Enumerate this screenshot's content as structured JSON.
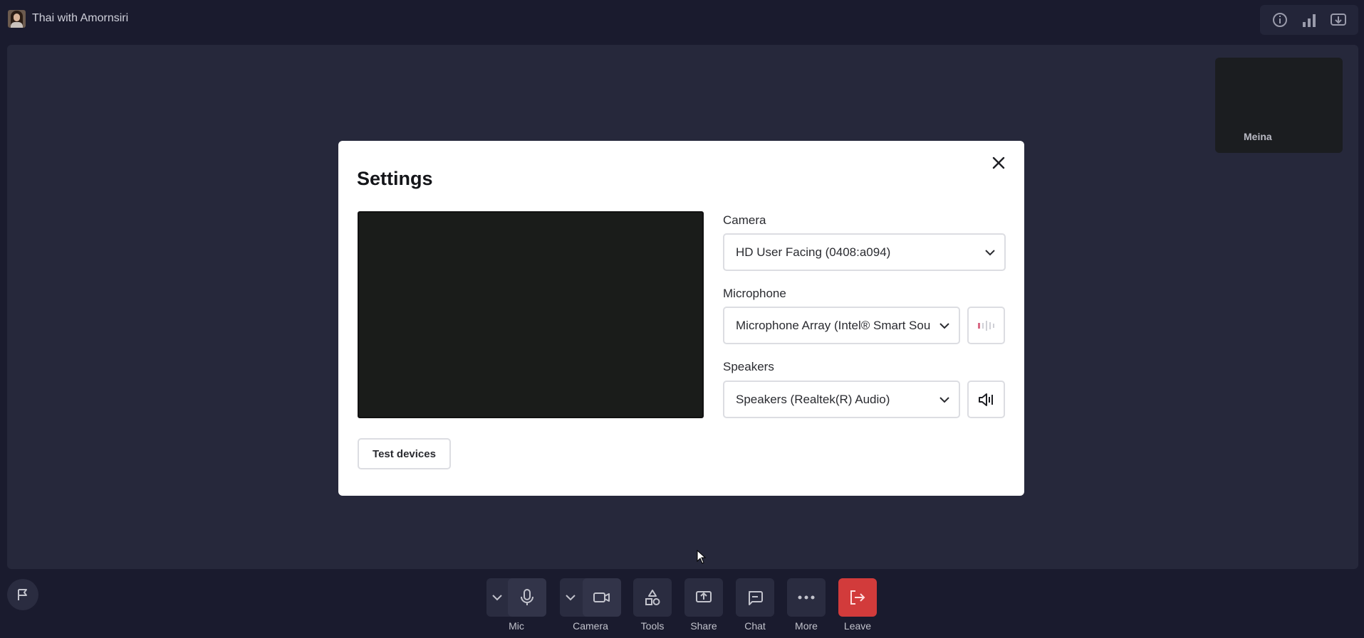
{
  "header": {
    "meeting_title": "Thai with Amornsiri"
  },
  "participant_tile": {
    "name": "Meina"
  },
  "settings_modal": {
    "title": "Settings",
    "camera": {
      "label": "Camera",
      "selected": "HD User Facing (0408:a094)"
    },
    "microphone": {
      "label": "Microphone",
      "selected": "Microphone Array (Intel® Smart Sound Technology)"
    },
    "speakers": {
      "label": "Speakers",
      "selected": "Speakers (Realtek(R) Audio)"
    },
    "test_devices_label": "Test devices"
  },
  "toolbar": {
    "mic_label": "Mic",
    "camera_label": "Camera",
    "tools_label": "Tools",
    "share_label": "Share",
    "chat_label": "Chat",
    "more_label": "More",
    "leave_label": "Leave"
  },
  "colors": {
    "background": "#1a1b2e",
    "stage": "#26283b",
    "control": "#2a2c40",
    "leave": "#d23b3b",
    "modal": "#ffffff"
  }
}
